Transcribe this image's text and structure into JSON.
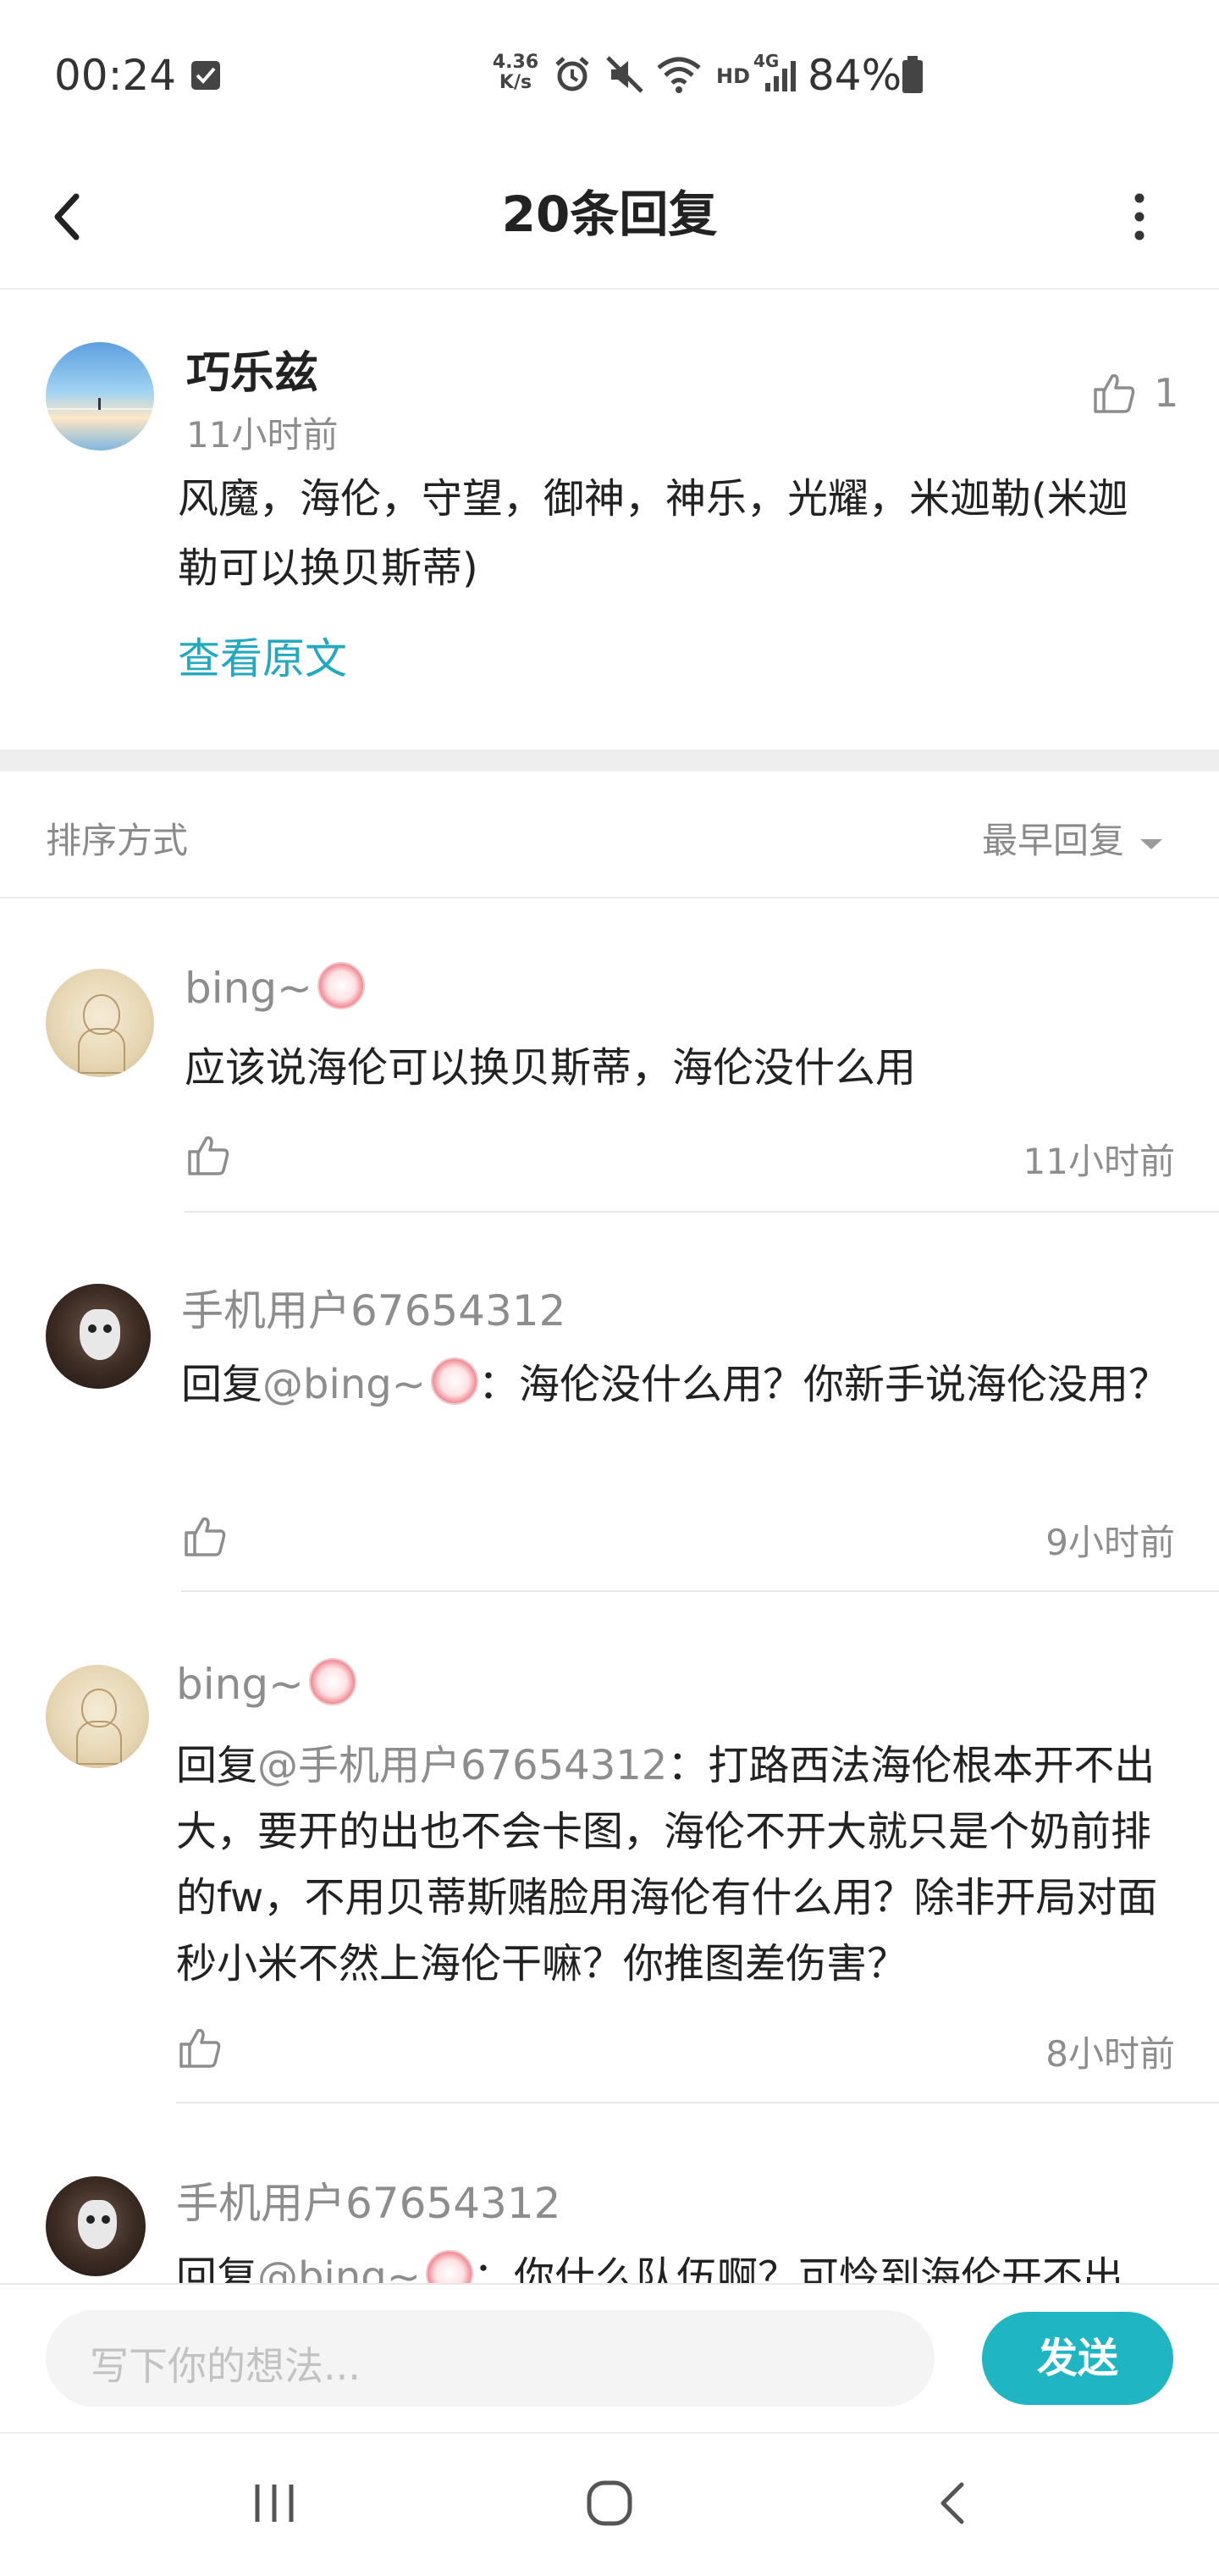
{
  "status_bar": {
    "time": "00:24",
    "net_speed_value": "4.36",
    "net_speed_unit": "K/s",
    "hd_label": "HD",
    "net_type": "4G",
    "battery": "84%"
  },
  "header": {
    "title": "20条回复"
  },
  "original_post": {
    "username": "巧乐兹",
    "time": "11小时前",
    "like_count": "1",
    "text": "风魔，海伦，守望，御神，神乐，光耀，米迦勒(米迦勒可以换贝斯蒂)",
    "view_original": "查看原文"
  },
  "sort": {
    "label": "排序方式",
    "selected": "最早回复"
  },
  "replies": [
    {
      "username": "bing~",
      "prefix": "",
      "mention": "",
      "text": "应该说海伦可以换贝斯蒂，海伦没什么用",
      "time": "11小时前"
    },
    {
      "username": "手机用户67654312",
      "prefix": "回复",
      "mention": "@bing~",
      "text": "：海伦没什么用？你新手说海伦没用？",
      "time": "9小时前"
    },
    {
      "username": "bing~",
      "prefix": "回复",
      "mention": "@手机用户67654312",
      "text": "：打路西法海伦根本开不出大，要开的出也不会卡图，海伦不开大就只是个奶前排的fw，不用贝蒂斯赌脸用海伦有什么用？除非开局对面秒小米不然上海伦干嘛？你推图差伤害？",
      "time": "8小时前"
    },
    {
      "username": "手机用户67654312",
      "prefix": "回复",
      "mention": "@bing~",
      "text": "：你什么队伍啊？可怜到海伦开不出",
      "time": ""
    }
  ],
  "input": {
    "placeholder": "写下你的想法...",
    "send_label": "发送"
  },
  "colors": {
    "accent": "#1fb5c3",
    "link": "#22a9bf",
    "grey_text": "#8d8d8d"
  }
}
